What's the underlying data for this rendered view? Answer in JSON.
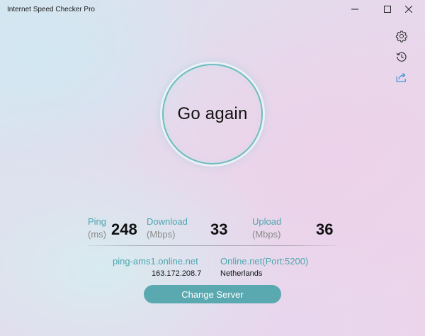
{
  "window": {
    "title": "Internet Speed Checker Pro"
  },
  "sidebar": {
    "icons": [
      "gear-icon",
      "history-icon",
      "share-icon"
    ]
  },
  "main": {
    "go_button_label": "Go again"
  },
  "results": {
    "ping": {
      "label": "Ping",
      "unit": "(ms)",
      "value": "248"
    },
    "download": {
      "label": "Download",
      "unit": "(Mbps)",
      "value": "33"
    },
    "upload": {
      "label": "Upload",
      "unit": "(Mbps)",
      "value": "36"
    }
  },
  "server": {
    "host": "ping-ams1.online.net",
    "ip": "163.172.208.7",
    "provider": "Online.net(Port:5200)",
    "country": "Netherlands",
    "change_label": "Change Server"
  },
  "colors": {
    "accent": "#4ba6ae",
    "button": "#5aa9b0",
    "ring": "#6fbcc0",
    "share_icon": "#3a9ad9"
  }
}
